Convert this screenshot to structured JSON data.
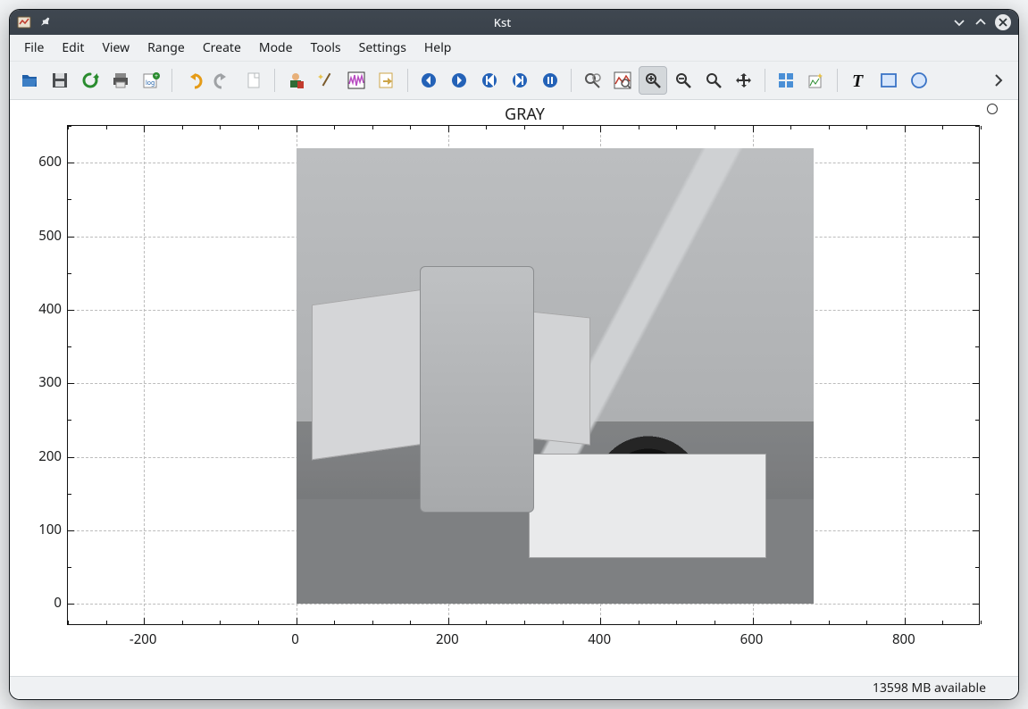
{
  "window": {
    "title": "Kst"
  },
  "menubar": {
    "items": [
      "File",
      "Edit",
      "View",
      "Range",
      "Create",
      "Mode",
      "Tools",
      "Settings",
      "Help"
    ]
  },
  "toolbar": {
    "groups": [
      [
        {
          "name": "open-icon",
          "title": "Open"
        },
        {
          "name": "save-icon",
          "title": "Save"
        },
        {
          "name": "reload-icon",
          "title": "Reload"
        },
        {
          "name": "print-icon",
          "title": "Print"
        },
        {
          "name": "log-icon",
          "title": "Log"
        }
      ],
      [
        {
          "name": "undo-icon",
          "title": "Back"
        },
        {
          "name": "redo-icon",
          "title": "Forward"
        },
        {
          "name": "page-icon",
          "title": "New Tab"
        }
      ],
      [
        {
          "name": "wizard-data-icon",
          "title": "Data Wizard"
        },
        {
          "name": "wand-icon",
          "title": "Change Data File"
        },
        {
          "name": "waveform-icon",
          "title": "Data Manager"
        },
        {
          "name": "export-icon",
          "title": "Export"
        }
      ],
      [
        {
          "name": "nav-left-icon",
          "title": "Scroll Left"
        },
        {
          "name": "nav-right-icon",
          "title": "Scroll Right"
        },
        {
          "name": "nav-first-icon",
          "title": "Read From End"
        },
        {
          "name": "nav-last-icon",
          "title": "Count From End"
        },
        {
          "name": "nav-pause-icon",
          "title": "Pause"
        }
      ],
      [
        {
          "name": "zoom-xy-icon",
          "title": "XY Zoom"
        },
        {
          "name": "zoom-x-icon",
          "title": "X Zoom"
        },
        {
          "name": "zoom-tied-icon",
          "title": "Tied Zoom",
          "active": true
        },
        {
          "name": "zoom-y-icon",
          "title": "Y Zoom"
        },
        {
          "name": "zoom-out-icon",
          "title": "Zoom Out"
        },
        {
          "name": "zoom-fit-icon",
          "title": "Zoom Fit"
        }
      ],
      [
        {
          "name": "layout-grid-icon",
          "title": "Layout"
        },
        {
          "name": "new-plot-icon",
          "title": "New Plot"
        }
      ],
      [
        {
          "name": "text-tool-icon",
          "title": "T"
        },
        {
          "name": "rect-tool-icon",
          "title": "Box"
        },
        {
          "name": "circle-tool-icon",
          "title": "Circle"
        }
      ]
    ],
    "overflow_label": "More"
  },
  "plot": {
    "title": "GRAY",
    "x_ticks": [
      -200,
      0,
      200,
      400,
      600,
      800
    ],
    "y_ticks": [
      0,
      100,
      200,
      300,
      400,
      500,
      600
    ],
    "xrange": [
      -300,
      900
    ],
    "yrange": [
      -30,
      650
    ],
    "image_extent_x": [
      0,
      680
    ],
    "image_extent_y": [
      0,
      620
    ]
  },
  "status": {
    "memory": "13598 MB available"
  },
  "chart_data": {
    "type": "image",
    "title": "GRAY",
    "xlabel": "",
    "ylabel": "",
    "xlim": [
      -300,
      900
    ],
    "ylim": [
      -30,
      650
    ],
    "x_ticks": [
      -200,
      0,
      200,
      400,
      600,
      800
    ],
    "y_ticks": [
      0,
      100,
      200,
      300,
      400,
      500,
      600
    ],
    "image": {
      "description": "Grayscale photograph of a scientific balloon payload / gondola with solar panels, suspended from a mobile launch crane with a large tire, on a flat field under a clear sky.",
      "extent_x": [
        0,
        680
      ],
      "extent_y": [
        0,
        620
      ]
    }
  }
}
